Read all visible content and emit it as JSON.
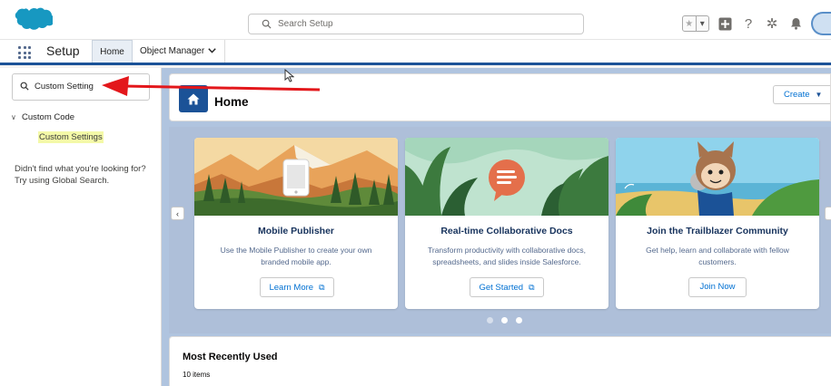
{
  "colors": {
    "brand": "#1b5297",
    "link": "#0070d2",
    "highlight": "#f4f9a8",
    "annotation_arrow": "#e3171b",
    "carousel_bg": "#aebfd9"
  },
  "global_header": {
    "logo_icon": "salesforce-cloud-logo",
    "search_placeholder": "Search Setup",
    "icons": [
      "favorites-star-icon",
      "favorites-dropdown-icon",
      "global-actions-plus-icon",
      "help-question-icon",
      "setup-gear-icon",
      "notifications-bell-icon",
      "user-avatar"
    ]
  },
  "nav": {
    "app_launcher_icon": "app-launcher-waffle-icon",
    "app_name": "Setup",
    "tabs": [
      {
        "label": "Home",
        "active": true
      },
      {
        "label": "Object Manager",
        "has_dropdown": true
      }
    ]
  },
  "sidebar": {
    "quick_find_value": "Custom Setting",
    "tree": {
      "group_label": "Custom Code",
      "item_label": "Custom Settings"
    },
    "hint_line1": "Didn't find what you're looking for?",
    "hint_line2": "Try using Global Search."
  },
  "page_header": {
    "title": "Home",
    "create_label": "Create"
  },
  "carousel": {
    "cards": [
      {
        "title": "Mobile Publisher",
        "description": "Use the Mobile Publisher to create your own branded mobile app.",
        "button": "Learn More",
        "external": true
      },
      {
        "title": "Real-time Collaborative Docs",
        "description": "Transform productivity with collaborative docs, spreadsheets, and slides inside Salesforce.",
        "button": "Get Started",
        "external": true
      },
      {
        "title": "Join the Trailblazer Community",
        "description": "Get help, learn and collaborate with fellow customers.",
        "button": "Join Now",
        "external": false
      }
    ],
    "dots": 3,
    "active_dot": 2
  },
  "most_recently_used": {
    "title": "Most Recently Used",
    "count_label": "10 items"
  }
}
